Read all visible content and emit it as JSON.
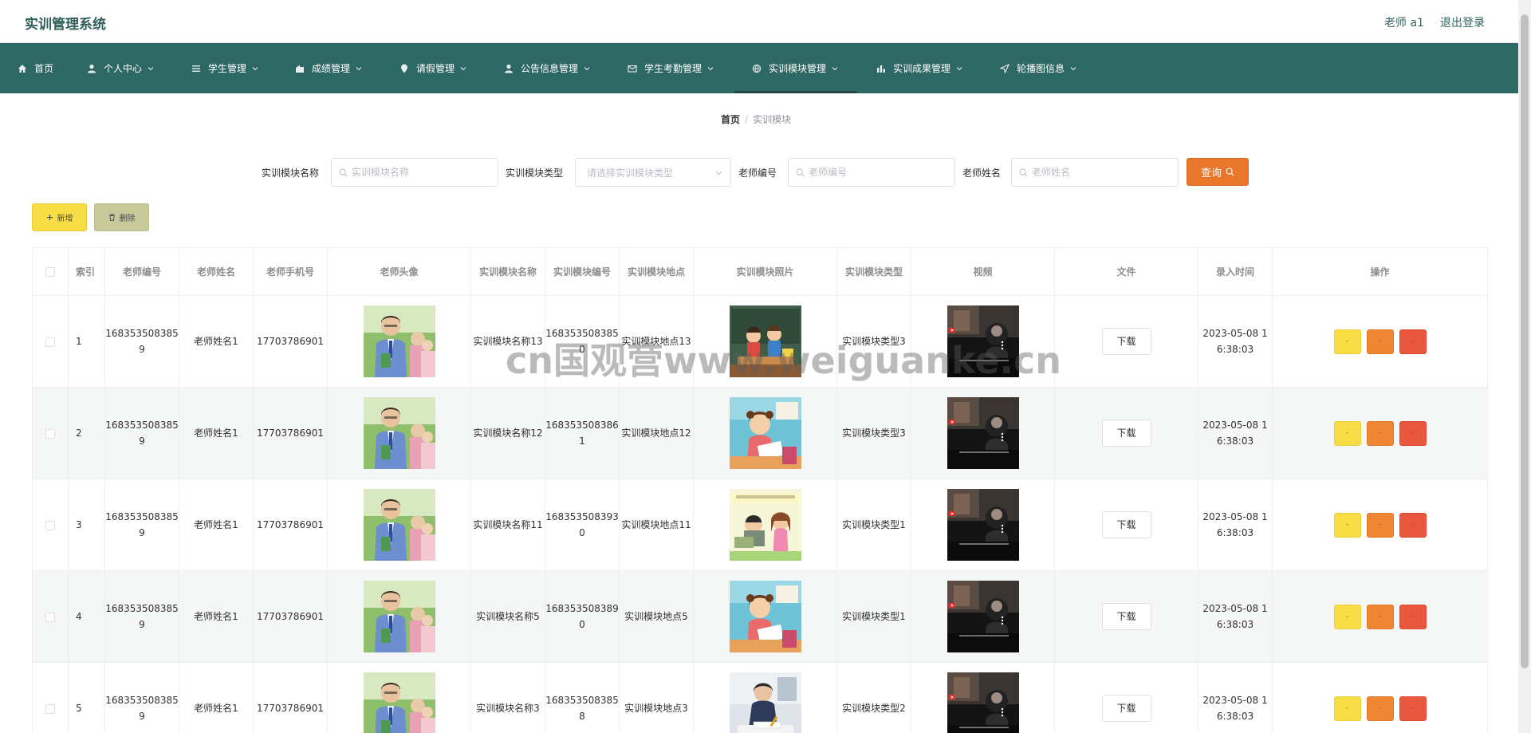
{
  "header": {
    "title": "实训管理系统",
    "user": "老师 a1",
    "logout": "退出登录"
  },
  "nav": {
    "active_index": 7,
    "items": [
      {
        "label": "首页",
        "icon": "home-icon",
        "has_dropdown": false
      },
      {
        "label": "个人中心",
        "icon": "user-icon",
        "has_dropdown": true
      },
      {
        "label": "学生管理",
        "icon": "list-icon",
        "has_dropdown": true
      },
      {
        "label": "成绩管理",
        "icon": "house-icon",
        "has_dropdown": true
      },
      {
        "label": "请假管理",
        "icon": "pin-icon",
        "has_dropdown": true
      },
      {
        "label": "公告信息管理",
        "icon": "user-icon",
        "has_dropdown": true
      },
      {
        "label": "学生考勤管理",
        "icon": "mail-icon",
        "has_dropdown": true
      },
      {
        "label": "实训模块管理",
        "icon": "ball-icon",
        "has_dropdown": true
      },
      {
        "label": "实训成果管理",
        "icon": "chart-icon",
        "has_dropdown": true
      },
      {
        "label": "轮播图信息",
        "icon": "send-icon",
        "has_dropdown": true
      }
    ]
  },
  "breadcrumb": {
    "home": "首页",
    "separator": "/",
    "current": "实训模块"
  },
  "filters": {
    "module_name_label": "实训模块名称",
    "module_name_placeholder": "实训模块名称",
    "module_type_label": "实训模块类型",
    "module_type_placeholder": "请选择实训模块类型",
    "teacher_no_label": "老师编号",
    "teacher_no_placeholder": "老师编号",
    "teacher_name_label": "老师姓名",
    "teacher_name_placeholder": "老师姓名",
    "search_label": "查询"
  },
  "toolbar": {
    "add_label": "新增",
    "delete_label": "删除"
  },
  "table": {
    "columns": [
      "",
      "索引",
      "老师编号",
      "老师姓名",
      "老师手机号",
      "老师头像",
      "实训模块名称",
      "实训模块编号",
      "实训模块地点",
      "实训模块照片",
      "实训模块类型",
      "视频",
      "文件",
      "录入时间",
      "操作"
    ],
    "download_label": "下载",
    "rows": [
      {
        "index": "1",
        "teacher_no": "1683535083859",
        "teacher_name": "老师姓名1",
        "phone": "17703786901",
        "module_name": "实训模块名称13",
        "module_no": "1683535083850",
        "location": "实训模块地点13",
        "photo": "classroom-illustration",
        "type": "实训模块类型3",
        "time": "2023-05-08 16:38:03"
      },
      {
        "index": "2",
        "teacher_no": "1683535083859",
        "teacher_name": "老师姓名1",
        "phone": "17703786901",
        "module_name": "实训模块名称12",
        "module_no": "1683535083861",
        "location": "实训模块地点12",
        "photo": "girl-studying-illustration",
        "type": "实训模块类型3",
        "time": "2023-05-08 16:38:03"
      },
      {
        "index": "3",
        "teacher_no": "1683535083859",
        "teacher_name": "老师姓名1",
        "phone": "17703786901",
        "module_name": "实训模块名称11",
        "module_no": "1683535083930",
        "location": "实训模块地点11",
        "photo": "kids-reading-illustration",
        "type": "实训模块类型1",
        "time": "2023-05-08 16:38:03"
      },
      {
        "index": "4",
        "teacher_no": "1683535083859",
        "teacher_name": "老师姓名1",
        "phone": "17703786901",
        "module_name": "实训模块名称5",
        "module_no": "1683535083890",
        "location": "实训模块地点5",
        "photo": "girl-studying-illustration",
        "type": "实训模块类型1",
        "time": "2023-05-08 16:38:03"
      },
      {
        "index": "5",
        "teacher_no": "1683535083859",
        "teacher_name": "老师姓名1",
        "phone": "17703786901",
        "module_name": "实训模块名称3",
        "module_no": "1683535083858",
        "location": "实训模块地点3",
        "photo": "child-writing-photo",
        "type": "实训模块类型2",
        "time": "2023-05-08 16:38:03"
      }
    ]
  },
  "watermark": "cn国观营www.weiguanke.cn",
  "colors": {
    "nav_bg": "#2e6865",
    "title": "#2f5f5a",
    "search_button": "#e8762b",
    "add_button": "#f8dd45",
    "delete_button": "#c7c99b",
    "op_view": "#f8dd45",
    "op_edit": "#ef8633",
    "op_delete": "#e9573f"
  }
}
